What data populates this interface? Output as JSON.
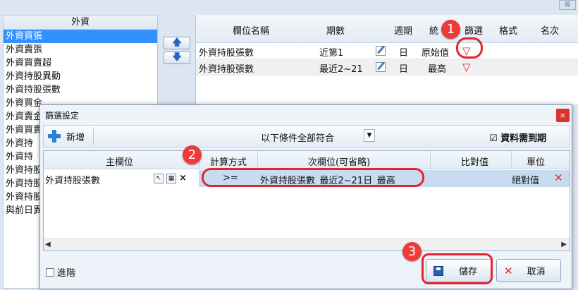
{
  "window": {
    "close_label": "⊠"
  },
  "fields_panel": {
    "header": "外資",
    "items": [
      {
        "label": "外資買張",
        "selected": true
      },
      {
        "label": "外資賣張"
      },
      {
        "label": "外資買賣超"
      },
      {
        "label": "外資持股異動"
      },
      {
        "label": "外資持股張數"
      },
      {
        "label": "外資買金"
      },
      {
        "label": "外資賣金"
      },
      {
        "label": "外資買賣"
      },
      {
        "label": "外資持"
      },
      {
        "label": "外資持"
      },
      {
        "label": "外資持股"
      },
      {
        "label": "外資持股"
      },
      {
        "label": "外資持股"
      },
      {
        "label": "與前日異"
      }
    ]
  },
  "move_buttons": {
    "up": "🡅",
    "down": "🡇"
  },
  "column_grid": {
    "headers": [
      "欄位名稱",
      "期數",
      "週期",
      "統",
      "篩選",
      "格式",
      "名次"
    ],
    "rows": [
      {
        "name": "外資持股張數",
        "period": "近第1",
        "cycle": "日",
        "stat": "原始值"
      },
      {
        "name": "外資持股張數",
        "period": "最近2~21",
        "cycle": "日",
        "stat": "最高"
      }
    ]
  },
  "badges": [
    "1",
    "2",
    "3"
  ],
  "dialog": {
    "title": "篩選設定",
    "close_label": "×",
    "toolbar": {
      "add_label": "新增",
      "condition_mode": "以下條件全部符合",
      "expire_label": "☑ 資料需到期"
    },
    "grid": {
      "headers": [
        "主欄位",
        "計算方式",
        "次欄位(可省略)",
        "比對值",
        "單位"
      ],
      "row": {
        "main_field": "外資持股張數",
        "operator": ">=",
        "secondary_field": "外資持股張數_最近2~21日_最高",
        "compare_value": "",
        "unit": "絕對值"
      }
    },
    "footer": {
      "advanced_label": "進階",
      "save_label": "儲存",
      "cancel_label": "取消"
    }
  },
  "colors": {
    "accent": "#3390ff",
    "highlight": "#e2252f",
    "badge": "#ef3a3a"
  }
}
